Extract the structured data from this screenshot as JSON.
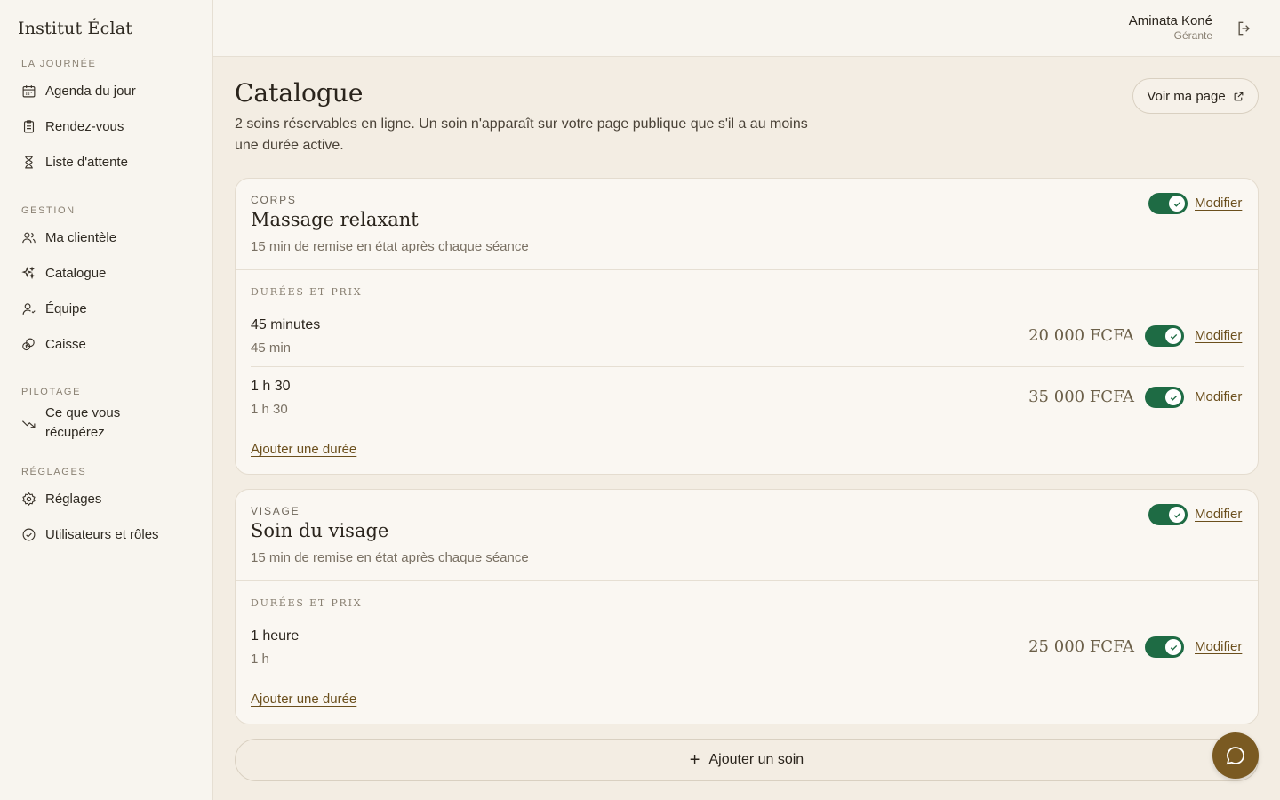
{
  "brand": "Institut Éclat",
  "sidebar": {
    "sections": [
      {
        "label": "LA JOURNÉE",
        "items": [
          {
            "label": "Agenda du jour",
            "icon": "calendar-icon"
          },
          {
            "label": "Rendez-vous",
            "icon": "clipboard-icon"
          },
          {
            "label": "Liste d'attente",
            "icon": "hourglass-icon"
          }
        ]
      },
      {
        "label": "GESTION",
        "items": [
          {
            "label": "Ma clientèle",
            "icon": "users-icon"
          },
          {
            "label": "Catalogue",
            "icon": "sparkles-icon"
          },
          {
            "label": "Équipe",
            "icon": "team-icon"
          },
          {
            "label": "Caisse",
            "icon": "coins-icon"
          }
        ]
      },
      {
        "label": "PILOTAGE",
        "items": [
          {
            "label": "Ce que vous récupérez",
            "icon": "trending-down-icon"
          }
        ]
      },
      {
        "label": "RÉGLAGES",
        "items": [
          {
            "label": "Réglages",
            "icon": "gear-icon"
          },
          {
            "label": "Utilisateurs et rôles",
            "icon": "check-circle-icon"
          }
        ]
      }
    ]
  },
  "user": {
    "name": "Aminata Koné",
    "role": "Gérante"
  },
  "page": {
    "title": "Catalogue",
    "description": "2 soins réservables en ligne. Un soin n'apparaît sur votre page publique que s'il a au moins une durée active.",
    "view_page_label": "Voir ma page"
  },
  "soins": [
    {
      "category": "CORPS",
      "name": "Massage relaxant",
      "note": "15 min de remise en état après chaque séance",
      "active": true,
      "edit_label": "Modifier",
      "durations_label": "DURÉES ET PRIX",
      "durations": [
        {
          "name": "45 minutes",
          "length": "45 min",
          "price": "20 000 FCFA",
          "active": true,
          "edit_label": "Modifier"
        },
        {
          "name": "1 h 30",
          "length": "1 h 30",
          "price": "35 000 FCFA",
          "active": true,
          "edit_label": "Modifier"
        }
      ],
      "add_duration_label": "Ajouter une durée"
    },
    {
      "category": "VISAGE",
      "name": "Soin du visage",
      "note": "15 min de remise en état après chaque séance",
      "active": true,
      "edit_label": "Modifier",
      "durations_label": "DURÉES ET PRIX",
      "durations": [
        {
          "name": "1 heure",
          "length": "1 h",
          "price": "25 000 FCFA",
          "active": true,
          "edit_label": "Modifier"
        }
      ],
      "add_duration_label": "Ajouter une durée"
    }
  ],
  "add_soin_label": "Ajouter un soin",
  "colors": {
    "accent": "#1e6b44",
    "link": "#6b4f1d",
    "fab": "#7a5a22",
    "background": "#f3ede3"
  }
}
